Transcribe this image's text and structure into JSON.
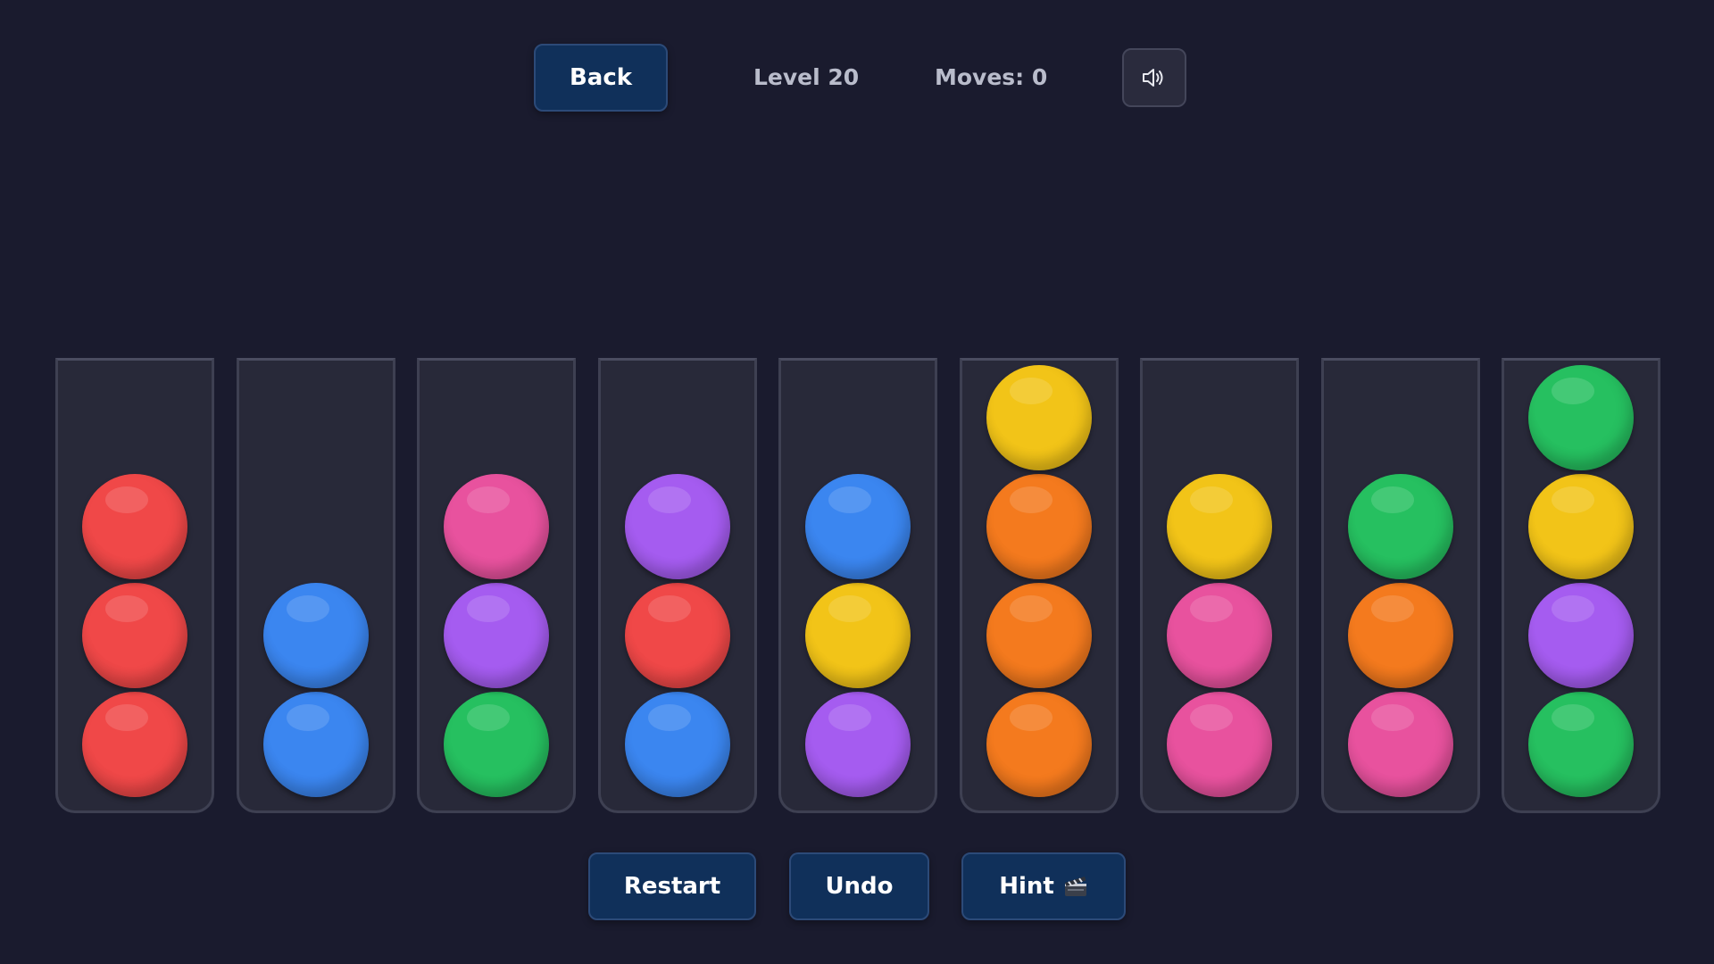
{
  "header": {
    "back_label": "Back",
    "level_label": "Level 20",
    "moves_label": "Moves: 0",
    "sound_icon": "speaker-icon"
  },
  "footer": {
    "restart_label": "Restart",
    "undo_label": "Undo",
    "hint_label": "Hint",
    "hint_icon": "clapperboard-icon"
  },
  "colors": {
    "red": "#f04848",
    "blue": "#3b86f0",
    "pink": "#e8529e",
    "purple": "#a55cf0",
    "green": "#26c060",
    "yellow": "#f2c418",
    "orange": "#f47a1e"
  },
  "tubes": [
    {
      "balls": [
        "red",
        "red",
        "red"
      ]
    },
    {
      "balls": [
        "blue",
        "blue"
      ]
    },
    {
      "balls": [
        "green",
        "purple",
        "pink"
      ]
    },
    {
      "balls": [
        "blue",
        "red",
        "purple"
      ]
    },
    {
      "balls": [
        "purple",
        "yellow",
        "blue"
      ]
    },
    {
      "balls": [
        "orange",
        "orange",
        "orange",
        "yellow"
      ]
    },
    {
      "balls": [
        "pink",
        "pink",
        "yellow"
      ]
    },
    {
      "balls": [
        "pink",
        "orange",
        "green"
      ]
    },
    {
      "balls": [
        "green",
        "purple",
        "yellow",
        "green"
      ]
    }
  ]
}
